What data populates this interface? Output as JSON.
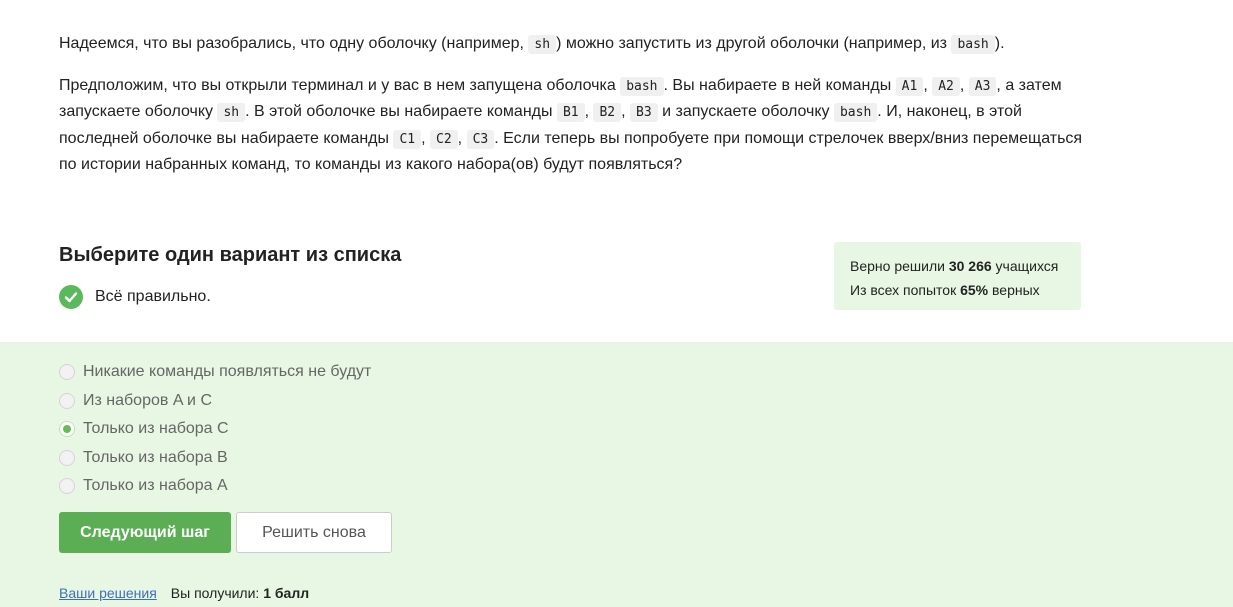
{
  "question": {
    "p1": {
      "t1": "Надеемся, что вы разобрались, что одну оболочку (например, ",
      "c1": "sh",
      "t2": ") можно запустить из другой оболочки (например, из ",
      "c2": "bash",
      "t3": ")."
    },
    "p2": {
      "t1": "Предположим, что вы открыли терминал и у вас в нем запущена оболочка ",
      "c_bash1": "bash",
      "t2": ". Вы набираете в ней команды ",
      "c_a1": "A1",
      "c_a2": "A2",
      "c_a3": "A3",
      "t3": ", а затем запускаете оболочку ",
      "c_sh": "sh",
      "t4": ". В этой оболочке вы набираете команды ",
      "c_b1": "B1",
      "c_b2": "B2",
      "c_b3": "B3",
      "t5": " и запускаете оболочку ",
      "c_bash2": "bash",
      "t6": ". И, наконец, в этой последней оболочке вы набираете команды ",
      "c_c1": "C1",
      "c_c2": "C2",
      "c_c3": "C3",
      "t7": ". Если теперь вы попробуете при помощи стрелочек вверх/вниз перемещаться по истории набранных команд, то команды из какого набора(ов) будут появляться?",
      "sep": ", "
    }
  },
  "choose_title": "Выберите один вариант из списка",
  "status": {
    "text": "Всё правильно.",
    "icon": "check-circle-icon",
    "color": "#5cb85c"
  },
  "stats": {
    "l1_prefix": "Верно решили ",
    "l1_value": "30 266",
    "l1_suffix": " учащихся",
    "l2_prefix": "Из всех попыток ",
    "l2_value": "65%",
    "l2_suffix": " верных"
  },
  "options": [
    {
      "label": "Никакие команды появляться не будут",
      "selected": false
    },
    {
      "label": "Из наборов A и C",
      "selected": false
    },
    {
      "label": "Только из набора C",
      "selected": true
    },
    {
      "label": "Только из набора B",
      "selected": false
    },
    {
      "label": "Только из набора A",
      "selected": false
    }
  ],
  "buttons": {
    "next": "Следующий шаг",
    "retry": "Решить снова"
  },
  "footer": {
    "solutions_link": "Ваши решения",
    "received_prefix": "Вы получили: ",
    "received_value": "1 балл"
  },
  "colors": {
    "accent": "#5cae55",
    "answer_bg": "#e8f7e4",
    "link": "#3d6fbe"
  }
}
